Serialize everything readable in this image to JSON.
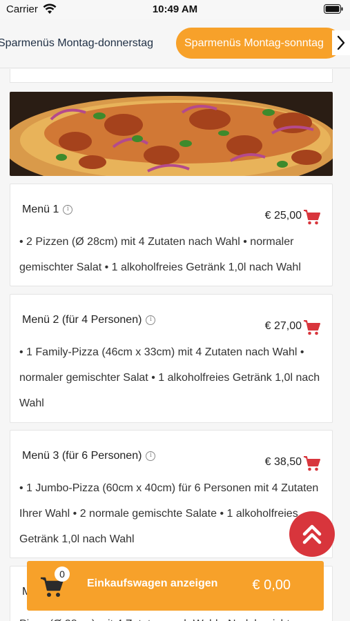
{
  "status_bar": {
    "carrier": "Carrier",
    "time": "10:49 AM"
  },
  "tabs": [
    {
      "label": "Sparmenüs Montag-donnerstag",
      "active": false
    },
    {
      "label": "Sparmenüs Montag-sonntag",
      "active": true
    }
  ],
  "menus": [
    {
      "title": "Menü 1",
      "price": "€ 25,00",
      "description": "• 2 Pizzen (Ø 28cm) mit 4 Zutaten nach Wahl • normaler gemischter Salat • 1 alkoholfreies Getränk 1,0l nach Wahl"
    },
    {
      "title": "Menü 2 (für 4 Personen)",
      "price": "€ 27,00",
      "description": "• 1 Family-Pizza (46cm x 33cm) mit 4 Zutaten nach Wahl • normaler gemischter Salat • 1 alkoholfreies Getränk 1,0l nach Wahl"
    },
    {
      "title": "Menü 3 (für 6 Personen)",
      "price": "€ 38,50",
      "description": "• 1 Jumbo-Pizza (60cm x 40cm) für 6 Personen mit 4 Zutaten Ihrer Wahl • 2 normale gemischte Salate • 1 alkoholfreies Getränk 1,0l nach Wahl"
    }
  ],
  "partial_card": {
    "title_fragment": "M",
    "desc_fragment": "Pizza (Ø 28cm) mit 4 Zutaten nach Wahl • Nudelgericht"
  },
  "cart": {
    "count": "0",
    "label": "Einkaufswagen anzeigen",
    "total": "€ 0,00"
  },
  "colors": {
    "accent": "#f7a12a",
    "cart_icon": "#d8353c",
    "scroll_button": "#d8353c"
  }
}
